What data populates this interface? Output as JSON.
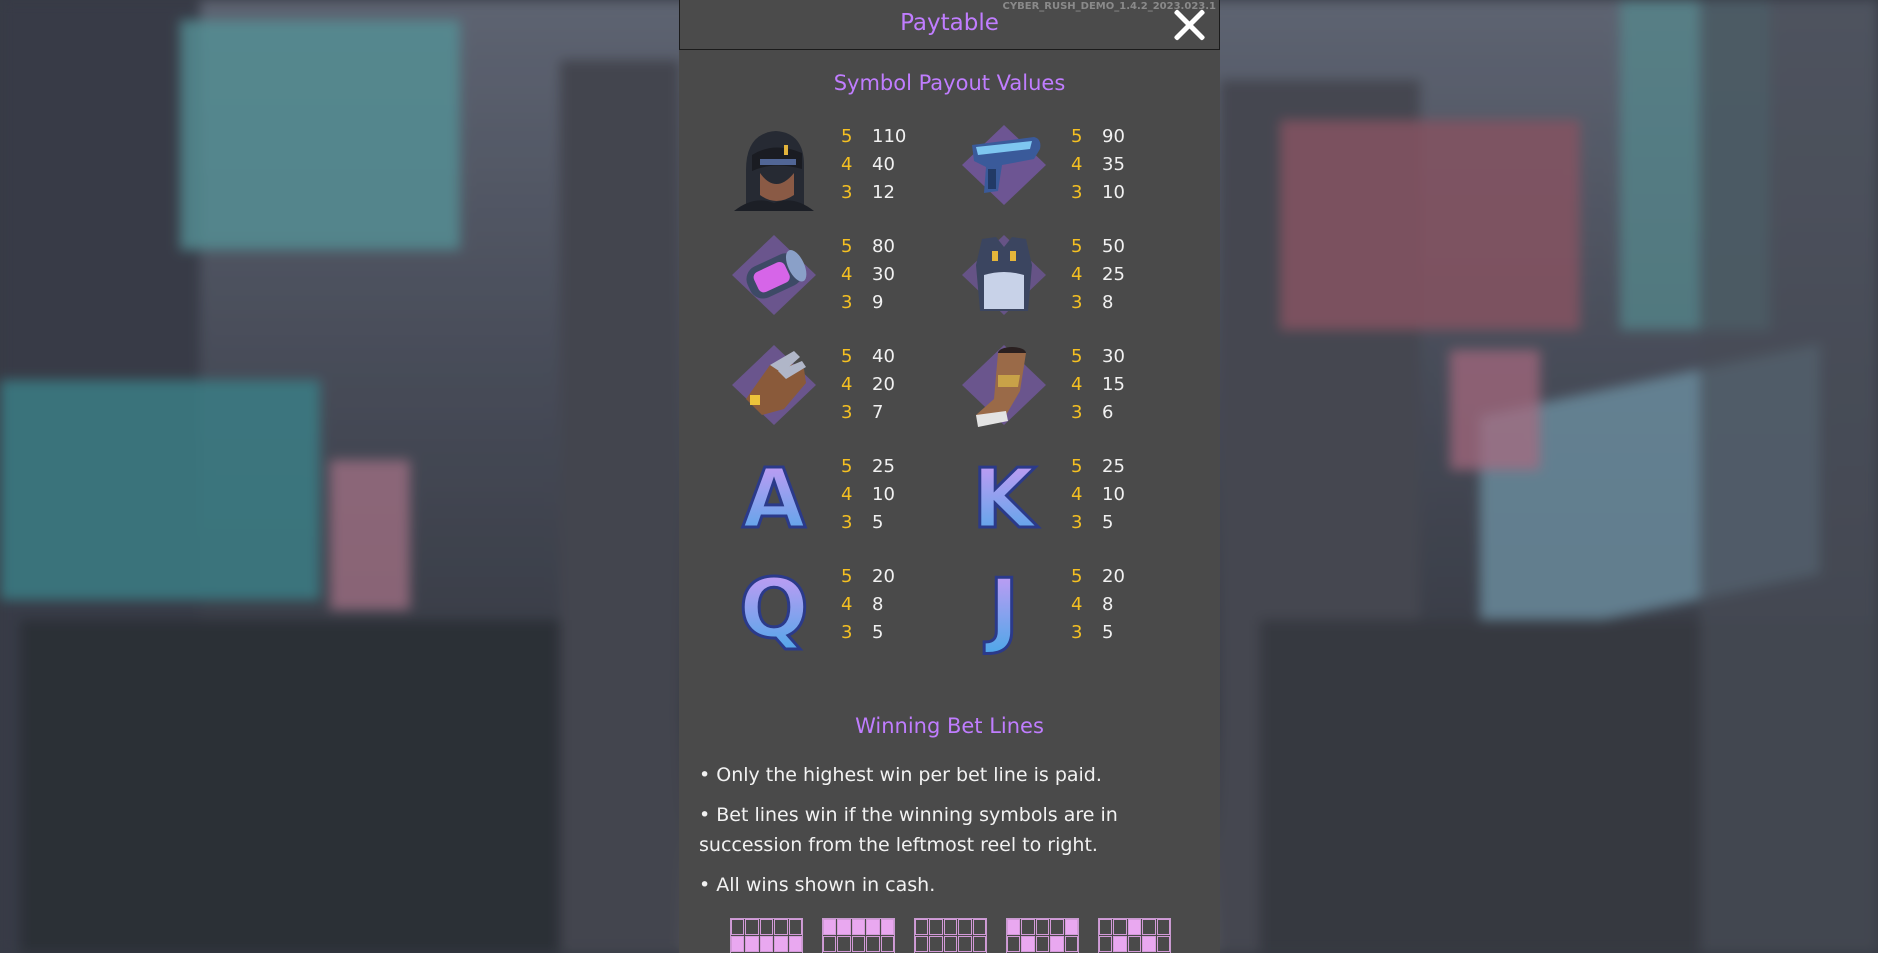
{
  "header": {
    "title": "Paytable",
    "version": "CYBER_RUSH_DEMO_1.4.2_2023.023.1"
  },
  "colors": {
    "accent_purple": "#c07dff",
    "count_gold": "#f5c022",
    "panel_bg": "#4a4a4a"
  },
  "symbol_section": {
    "title": "Symbol Payout Values",
    "symbols": [
      {
        "name": "cyber-helmet",
        "pays": [
          {
            "count": "5",
            "value": "110"
          },
          {
            "count": "4",
            "value": "40"
          },
          {
            "count": "3",
            "value": "12"
          }
        ]
      },
      {
        "name": "blaster-gun",
        "pays": [
          {
            "count": "5",
            "value": "90"
          },
          {
            "count": "4",
            "value": "35"
          },
          {
            "count": "3",
            "value": "10"
          }
        ]
      },
      {
        "name": "energy-cell",
        "pays": [
          {
            "count": "5",
            "value": "80"
          },
          {
            "count": "4",
            "value": "30"
          },
          {
            "count": "3",
            "value": "9"
          }
        ]
      },
      {
        "name": "armor-vest",
        "pays": [
          {
            "count": "5",
            "value": "50"
          },
          {
            "count": "4",
            "value": "25"
          },
          {
            "count": "3",
            "value": "8"
          }
        ]
      },
      {
        "name": "cyber-glove",
        "pays": [
          {
            "count": "5",
            "value": "40"
          },
          {
            "count": "4",
            "value": "20"
          },
          {
            "count": "3",
            "value": "7"
          }
        ]
      },
      {
        "name": "cyber-boot",
        "pays": [
          {
            "count": "5",
            "value": "30"
          },
          {
            "count": "4",
            "value": "15"
          },
          {
            "count": "3",
            "value": "6"
          }
        ]
      },
      {
        "name": "letter-a",
        "glyph": "A",
        "pays": [
          {
            "count": "5",
            "value": "25"
          },
          {
            "count": "4",
            "value": "10"
          },
          {
            "count": "3",
            "value": "5"
          }
        ]
      },
      {
        "name": "letter-k",
        "glyph": "K",
        "pays": [
          {
            "count": "5",
            "value": "25"
          },
          {
            "count": "4",
            "value": "10"
          },
          {
            "count": "3",
            "value": "5"
          }
        ]
      },
      {
        "name": "letter-q",
        "glyph": "Q",
        "pays": [
          {
            "count": "5",
            "value": "20"
          },
          {
            "count": "4",
            "value": "8"
          },
          {
            "count": "3",
            "value": "5"
          }
        ]
      },
      {
        "name": "letter-j",
        "glyph": "J",
        "pays": [
          {
            "count": "5",
            "value": "20"
          },
          {
            "count": "4",
            "value": "8"
          },
          {
            "count": "3",
            "value": "5"
          }
        ]
      }
    ]
  },
  "lines_section": {
    "title": "Winning Bet Lines",
    "rules": [
      "• Only the highest win per bet line is paid.",
      "• Bet lines win if the winning symbols are in succession from the leftmost reel to right.",
      "• All wins shown in cash."
    ],
    "bet_lines": [
      [
        0,
        0,
        0,
        0,
        0,
        1,
        1,
        1,
        1,
        1,
        0,
        0,
        0,
        0,
        0
      ],
      [
        1,
        1,
        1,
        1,
        1,
        0,
        0,
        0,
        0,
        0,
        0,
        0,
        0,
        0,
        0
      ],
      [
        0,
        0,
        0,
        0,
        0,
        0,
        0,
        0,
        0,
        0,
        1,
        1,
        1,
        1,
        1
      ],
      [
        1,
        0,
        0,
        0,
        1,
        0,
        1,
        0,
        1,
        0,
        0,
        0,
        1,
        0,
        0
      ],
      [
        0,
        0,
        1,
        0,
        0,
        0,
        1,
        0,
        1,
        0,
        1,
        0,
        0,
        0,
        1
      ]
    ]
  }
}
